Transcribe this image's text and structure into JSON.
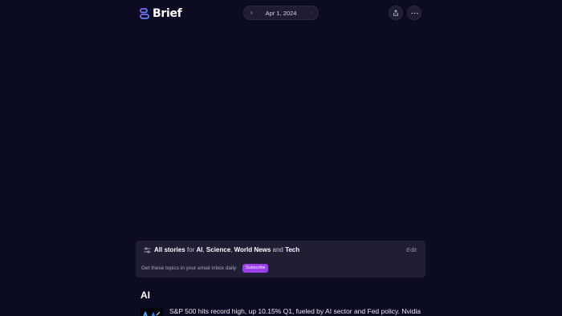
{
  "header": {
    "brand": "Brief",
    "date": "Apr 1, 2024",
    "prev_icon": "chevron-left-icon",
    "next_icon": "chevron-right-icon",
    "share_icon": "share-icon",
    "more_icon": "more-horizontal-icon"
  },
  "topics": {
    "lead": "All stories",
    "for_word": " for ",
    "topic_1": "AI",
    "sep_1": ", ",
    "topic_2": "Science",
    "sep_2": ", ",
    "topic_3": "World News",
    "and_word": " and ",
    "topic_4": "Tech",
    "edit_label": "Edit",
    "inbox_text": "Get these topics in your email inbox daily",
    "subscribe_label": "Subscribe",
    "filter_icon": "sliders-icon"
  },
  "section": {
    "title": "AI",
    "stories": [
      {
        "headline": "S&P 500 hits record high, up 10.15% Q1, fueled by AI sector and Fed policy. Nvidia"
      }
    ]
  },
  "colors": {
    "background": "#0c0b24",
    "card": "#1f1e34",
    "accent": "#9b3fe8",
    "logo_gradient_start": "#8b5cf6",
    "logo_gradient_end": "#5b8def"
  }
}
